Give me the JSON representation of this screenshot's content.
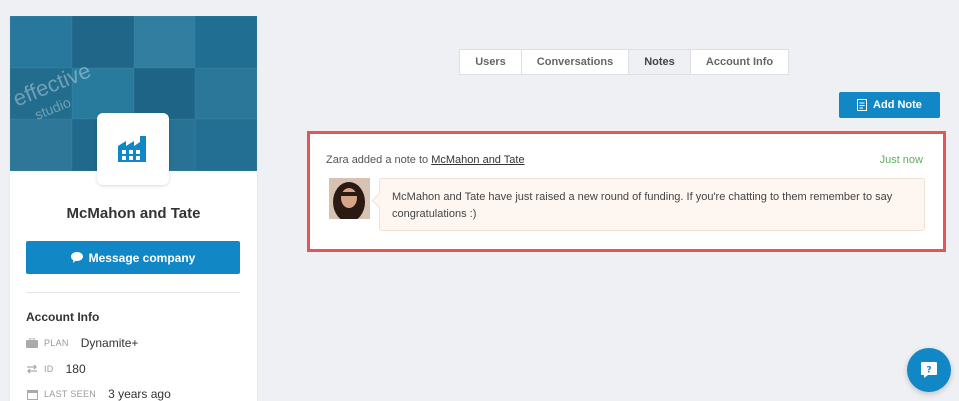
{
  "sidebar": {
    "cover_text": "effective",
    "cover_subtext": "studio",
    "company_name": "McMahon and Tate",
    "message_button_label": "Message company",
    "account_info_title": "Account Info",
    "attributes": [
      {
        "label": "PLAN",
        "value": "Dynamite+",
        "icon": "briefcase-icon"
      },
      {
        "label": "ID",
        "value": "180",
        "icon": "arrows-icon"
      },
      {
        "label": "LAST SEEN",
        "value": "3 years ago",
        "icon": "calendar-icon"
      }
    ]
  },
  "tabs": [
    {
      "label": "Users",
      "active": false
    },
    {
      "label": "Conversations",
      "active": false
    },
    {
      "label": "Notes",
      "active": true
    },
    {
      "label": "Account Info",
      "active": false
    }
  ],
  "add_note_label": "Add Note",
  "note": {
    "author": "Zara",
    "action_text": "added a note to",
    "target": "McMahon and Tate",
    "time": "Just now",
    "body": "McMahon and Tate have just raised a new round of funding. If you're chatting to them remember to say congratulations :)"
  },
  "colors": {
    "accent": "#1187c6",
    "highlight": "#e45656",
    "time": "#5ab25a"
  }
}
